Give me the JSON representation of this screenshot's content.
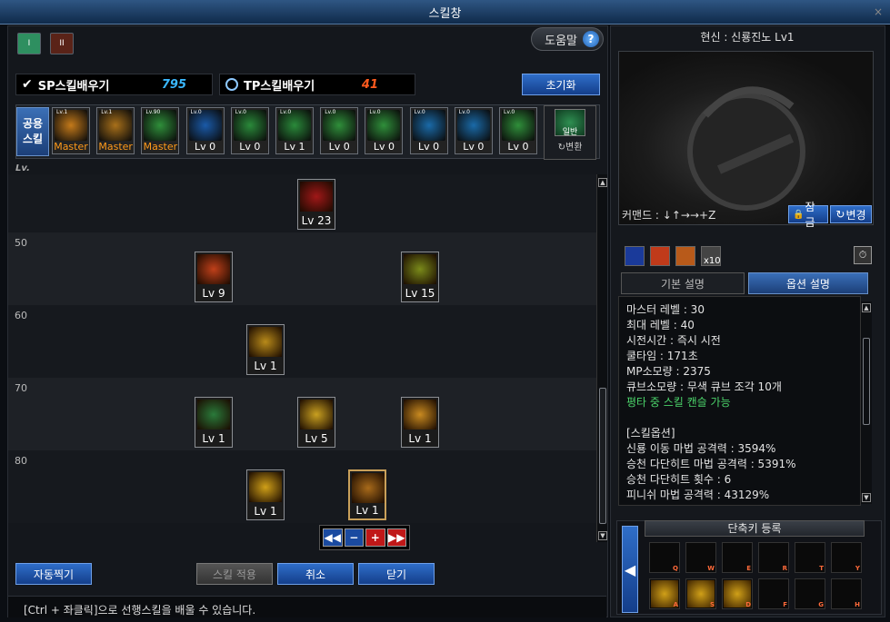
{
  "window": {
    "title": "스킬창"
  },
  "tabs": [
    {
      "label": "I",
      "color": "#2e8f60"
    },
    {
      "label": "II",
      "color": "#7a2a20"
    }
  ],
  "help": {
    "label": "도움말",
    "icon": "?"
  },
  "sp": {
    "label": "SP스킬배우기",
    "value": "795",
    "color": "#3ab8ff"
  },
  "tp": {
    "label": "TP스킬배우기",
    "value": "41",
    "color": "#ff5a1e"
  },
  "reset_label": "초기화",
  "common_label": [
    "공용",
    "스킬"
  ],
  "common_skills": [
    {
      "tag": "Lv.1",
      "lv": "Master",
      "color": "#c47a1a"
    },
    {
      "tag": "Lv.1",
      "lv": "Master",
      "color": "#a8701a"
    },
    {
      "tag": "Lv.90",
      "lv": "Master",
      "color": "#2f8f3a"
    },
    {
      "tag": "Lv.0",
      "lv": "Lv 0",
      "color": "#1a5aa8"
    },
    {
      "tag": "Lv.0",
      "lv": "Lv 0",
      "color": "#2a8a3a"
    },
    {
      "tag": "Lv.0",
      "lv": "Lv 1",
      "color": "#2a8a3a"
    },
    {
      "tag": "Lv.0",
      "lv": "Lv 0",
      "color": "#2f8f3a"
    },
    {
      "tag": "Lv.0",
      "lv": "Lv 0",
      "color": "#2f8f3a"
    },
    {
      "tag": "Lv.0",
      "lv": "Lv 0",
      "color": "#1a6aa8"
    },
    {
      "tag": "Lv.0",
      "lv": "Lv 0",
      "color": "#1a6aa8"
    },
    {
      "tag": "Lv.0",
      "lv": "Lv 0",
      "color": "#2f8f3a"
    }
  ],
  "convert": {
    "top": "일반",
    "label": "↻변환"
  },
  "tree_header": "Lv.",
  "rows": [
    "",
    "50",
    "60",
    "70",
    "80"
  ],
  "nodes": [
    {
      "lv": "Lv 23",
      "color": "#a01818",
      "selected": false
    },
    {
      "lv": "Lv 9",
      "color": "#c0401a",
      "selected": false
    },
    {
      "lv": "Lv 15",
      "color": "#7a8a1a",
      "selected": false
    },
    {
      "lv": "Lv 1",
      "color": "#b88a1a",
      "selected": false
    },
    {
      "lv": "Lv 1",
      "color": "#2a7a3a",
      "selected": false
    },
    {
      "lv": "Lv 5",
      "color": "#c9a020",
      "selected": false
    },
    {
      "lv": "Lv 1",
      "color": "#c98a20",
      "selected": false
    },
    {
      "lv": "Lv 1",
      "color": "#d0a018",
      "selected": false
    },
    {
      "lv": "Lv 1",
      "color": "#a86a1a",
      "selected": true
    }
  ],
  "controls": [
    "◀◀",
    "−",
    "+",
    "▶▶"
  ],
  "buttons": {
    "auto": "자동찍기",
    "apply": "스킬 적용",
    "cancel": "취소",
    "close": "닫기"
  },
  "footer": "[Ctrl + 좌클릭]으로 선행스킬을 배울 수 있습니다.",
  "right": {
    "title": "현신 : 신룡진노 Lv1",
    "command": "커맨드 : ↓↑→→+Z",
    "lock": "잠금",
    "change": "변경",
    "x10": "x10",
    "tab_basic": "기본 설명",
    "tab_option": "옵션 설명",
    "desc": [
      {
        "t": "마스터 레벨 : 30",
        "c": ""
      },
      {
        "t": "최대 레벨 : 40",
        "c": ""
      },
      {
        "t": "시전시간 : 즉시 시전",
        "c": ""
      },
      {
        "t": "쿨타임 : 171초",
        "c": ""
      },
      {
        "t": "MP소모량 : 2375",
        "c": ""
      },
      {
        "t": "큐브소모량 : 무색 큐브 조각 10개",
        "c": ""
      },
      {
        "t": "평타 중 스킬 캔슬 가능",
        "c": "g"
      },
      {
        "t": "",
        "c": ""
      },
      {
        "t": "[스킬옵션]",
        "c": ""
      },
      {
        "t": "신룡 이동 마법 공격력 : 3594%",
        "c": ""
      },
      {
        "t": "승천 다단히트 마법 공격력 : 5391%",
        "c": ""
      },
      {
        "t": "승천 다단히트 횟수 : 6",
        "c": ""
      },
      {
        "t": "피니쉬 마법 공격력 : 43129%",
        "c": ""
      }
    ],
    "hotkey_title": "단축키 등록",
    "hotkeys": [
      "Q",
      "W",
      "E",
      "R",
      "T",
      "Y",
      "A",
      "S",
      "D",
      "F",
      "G",
      "H"
    ],
    "hotkey_filled": [
      "A",
      "S",
      "D"
    ]
  }
}
